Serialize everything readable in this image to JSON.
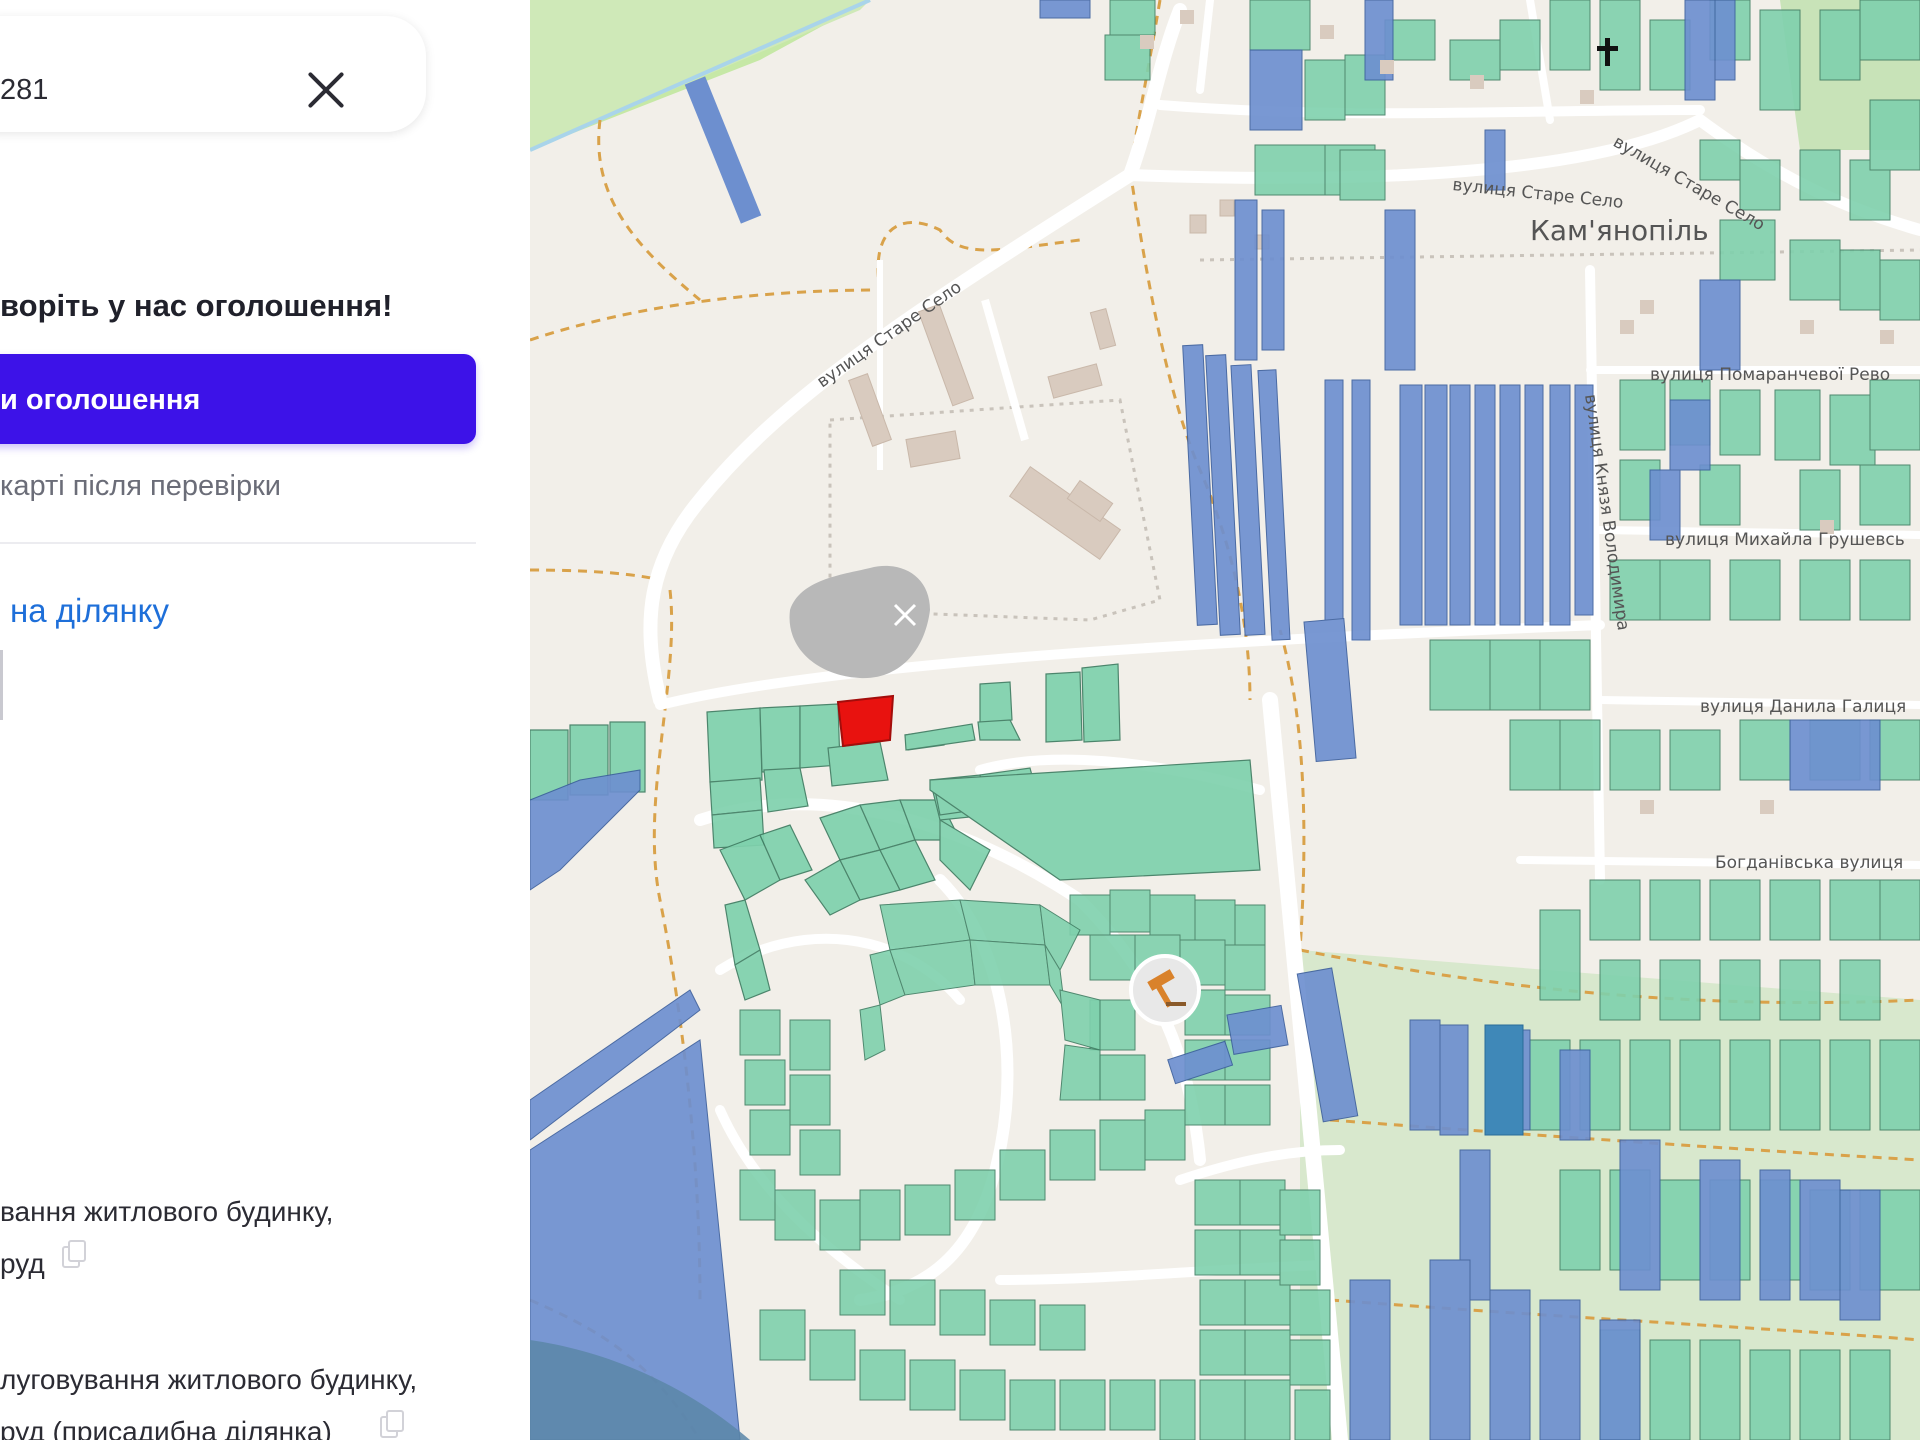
{
  "search": {
    "value": "281"
  },
  "promo": {
    "heading": "воріть у нас оголошення!",
    "button_label": "и оголошення",
    "note": "карті після перевірки"
  },
  "plot_link": "на ділянку",
  "purposes": [
    {
      "line1": "вання житлового будинку,",
      "line2": "руд"
    },
    {
      "line1": "луговування житлового будинку,",
      "line2": "руд (присадибна ділянка)"
    }
  ],
  "map": {
    "place_name": "Кам'янопіль",
    "streets": [
      "вулиця Старе Село",
      "вулиця Старе Село",
      "вулиця Старе Село",
      "вулиця Помаранчевої Рево",
      "вулиця Князя Володимира",
      "вулиця Михайла Грушевсь",
      "вулиця Данила Галиця",
      "Богданівська вулиця"
    ],
    "colors": {
      "parcel_green": "#7fd1ad",
      "parcel_blue": "#6d8fcf",
      "selected_parcel": "#e8120f",
      "land": "#f2efe9",
      "road": "#ffffff",
      "quarry": "#b8b8b8"
    },
    "icons": [
      "auction-hammer-icon",
      "church-cross-icon",
      "quarry-icon"
    ]
  }
}
